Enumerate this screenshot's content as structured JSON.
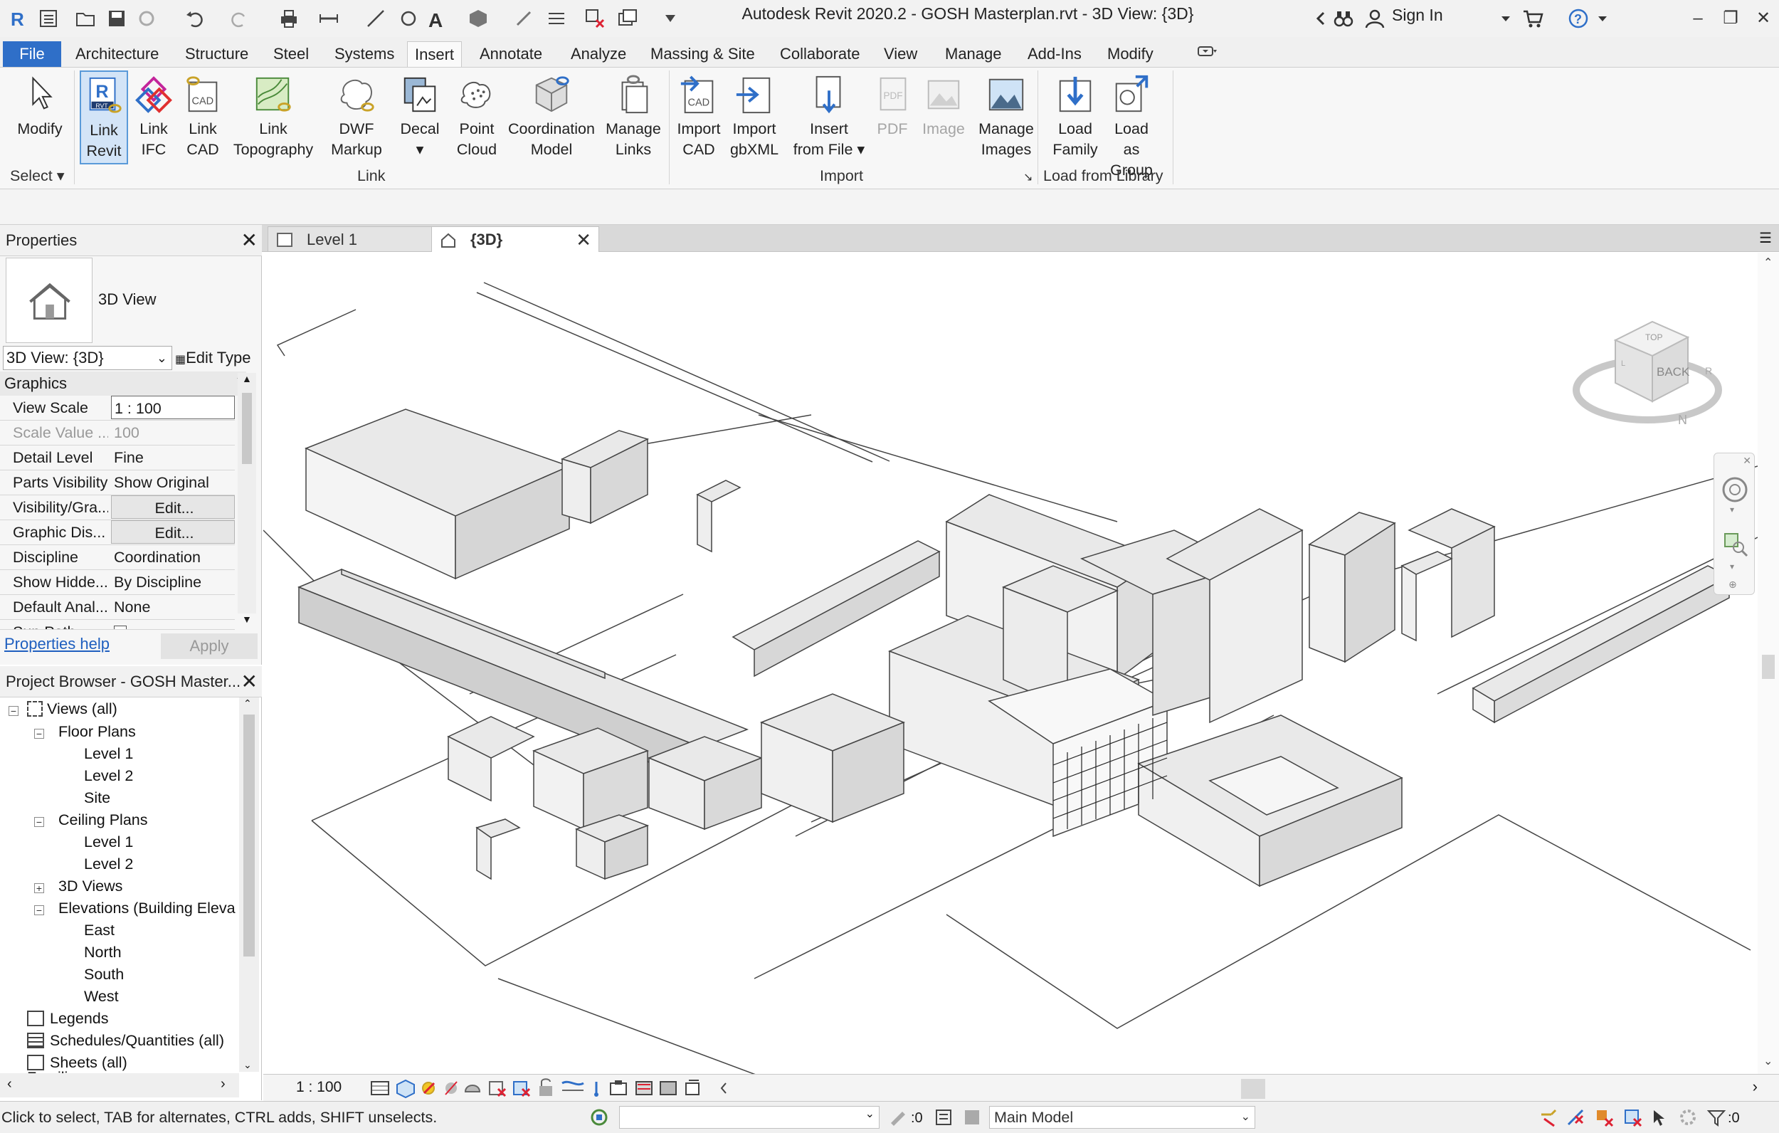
{
  "titlebar": {
    "title": "Autodesk Revit 2020.2 - GOSH Masterplan.rvt - 3D View: {3D}",
    "sign_in": "Sign In"
  },
  "menu": {
    "tabs": [
      "File",
      "Architecture",
      "Structure",
      "Steel",
      "Systems",
      "Insert",
      "Annotate",
      "Analyze",
      "Massing & Site",
      "Collaborate",
      "View",
      "Manage",
      "Add-Ins",
      "Modify"
    ],
    "active": "Insert"
  },
  "ribbon": {
    "select": {
      "modify": "Modify",
      "panel": "Select"
    },
    "link": {
      "link_revit": [
        "Link",
        "Revit"
      ],
      "link_ifc": [
        "Link",
        "IFC"
      ],
      "link_cad": [
        "Link",
        "CAD"
      ],
      "link_topography": [
        "Link",
        "Topography"
      ],
      "dwf_markup": [
        "DWF",
        "Markup"
      ],
      "decal": "Decal",
      "point_cloud": [
        "Point",
        "Cloud"
      ],
      "coordination_model": [
        "Coordination",
        "Model"
      ],
      "manage_links": [
        "Manage",
        "Links"
      ],
      "panel": "Link"
    },
    "import": {
      "import_cad": [
        "Import",
        "CAD"
      ],
      "import_gbxml": [
        "Import",
        "gbXML"
      ],
      "insert_from_file": [
        "Insert",
        "from File"
      ],
      "pdf": "PDF",
      "image": "Image",
      "manage_images": [
        "Manage",
        "Images"
      ],
      "panel": "Import"
    },
    "library": {
      "load_family": [
        "Load",
        "Family"
      ],
      "load_as_group": [
        "Load as",
        "Group"
      ],
      "panel": "Load from Library"
    },
    "icon_badges": {
      "rvt": "RVT",
      "cad": "CAD",
      "pdf": "PDF"
    }
  },
  "properties": {
    "header": "Properties",
    "type_name": "3D View",
    "view_selector": "3D View: {3D}",
    "edit_type": "Edit Type",
    "group": "Graphics",
    "rows": [
      {
        "k": "View Scale",
        "v": "1 : 100"
      },
      {
        "k": "Scale Value ...",
        "v": "100"
      },
      {
        "k": "Detail Level",
        "v": "Fine"
      },
      {
        "k": "Parts Visibility",
        "v": "Show Original"
      },
      {
        "k": "Visibility/Gra...",
        "v": "Edit..."
      },
      {
        "k": "Graphic Dis...",
        "v": "Edit..."
      },
      {
        "k": "Discipline",
        "v": "Coordination"
      },
      {
        "k": "Show Hidde...",
        "v": "By Discipline"
      },
      {
        "k": "Default Anal...",
        "v": "None"
      },
      {
        "k": "Sun Path",
        "v": ""
      }
    ],
    "help": "Properties help",
    "apply": "Apply"
  },
  "browser": {
    "header": "Project Browser - GOSH Master...",
    "tree": {
      "views": "Views (all)",
      "floor_plans": "Floor Plans",
      "fp_level1": "Level 1",
      "fp_level2": "Level 2",
      "fp_site": "Site",
      "ceiling_plans": "Ceiling Plans",
      "cp_level1": "Level 1",
      "cp_level2": "Level 2",
      "views3d": "3D Views",
      "elevations": "Elevations (Building Eleva",
      "east": "East",
      "north": "North",
      "south": "South",
      "west": "West",
      "legends": "Legends",
      "schedules": "Schedules/Quantities (all)",
      "sheets": "Sheets (all)",
      "families": "Famili..."
    }
  },
  "view_tabs": {
    "level1": "Level 1",
    "threed": "{3D}"
  },
  "viewcube": {
    "top": "TOP",
    "back": "BACK",
    "left": "L",
    "right": "R",
    "north": "N"
  },
  "view_control": {
    "scale": "1 : 100"
  },
  "status": {
    "message": "Click to select, TAB for alternates, CTRL adds, SHIFT unselects.",
    "zero1": ":0",
    "model": "Main Model",
    "zero2": ":0"
  }
}
